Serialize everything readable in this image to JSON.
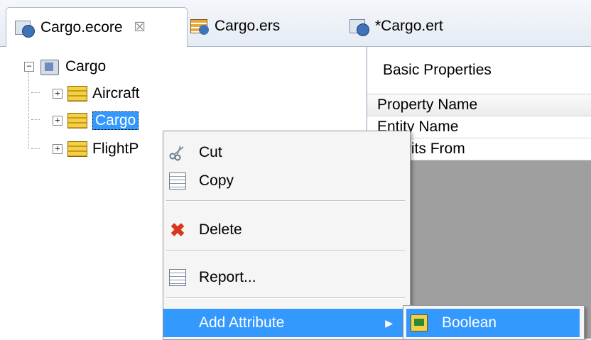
{
  "tabs": [
    {
      "label": "Cargo.ecore",
      "icon": "ecore-file-icon",
      "close": "☒",
      "active": true
    },
    {
      "label": "Cargo.ers",
      "icon": "ers-file-icon",
      "active": false
    },
    {
      "label": "*Cargo.ert",
      "icon": "ert-file-icon",
      "active": false
    }
  ],
  "tree": {
    "root": {
      "label": "Cargo",
      "expander": "−",
      "icon": "package-icon"
    },
    "children": [
      {
        "label": "Aircraft",
        "expander": "+",
        "icon": "entity-icon"
      },
      {
        "label": "Cargo",
        "expander": "+",
        "icon": "entity-icon",
        "selected": true
      },
      {
        "label": "FlightP",
        "expander": "+",
        "icon": "entity-icon"
      }
    ]
  },
  "properties": {
    "section_title": "Basic Properties",
    "header": "Property Name",
    "rows": [
      "Entity Name",
      "Inherits From"
    ]
  },
  "context_menu": {
    "items": [
      {
        "label": "Cut",
        "icon": "scissors-icon"
      },
      {
        "label": "Copy",
        "icon": "copy-icon"
      },
      {
        "label": "Delete",
        "icon": "delete-icon"
      },
      {
        "label": "Report...",
        "icon": "report-icon"
      },
      {
        "label": "Add Attribute",
        "icon": "",
        "submenu_arrow": "▶",
        "highlighted": true
      }
    ],
    "submenu": [
      {
        "label": "Boolean",
        "icon": "boolean-attribute-icon",
        "highlighted": true
      }
    ]
  },
  "colors": {
    "selection": "#3399ff",
    "menu_bg": "#f5f5f5",
    "properties_bg": "#9f9f9f"
  }
}
